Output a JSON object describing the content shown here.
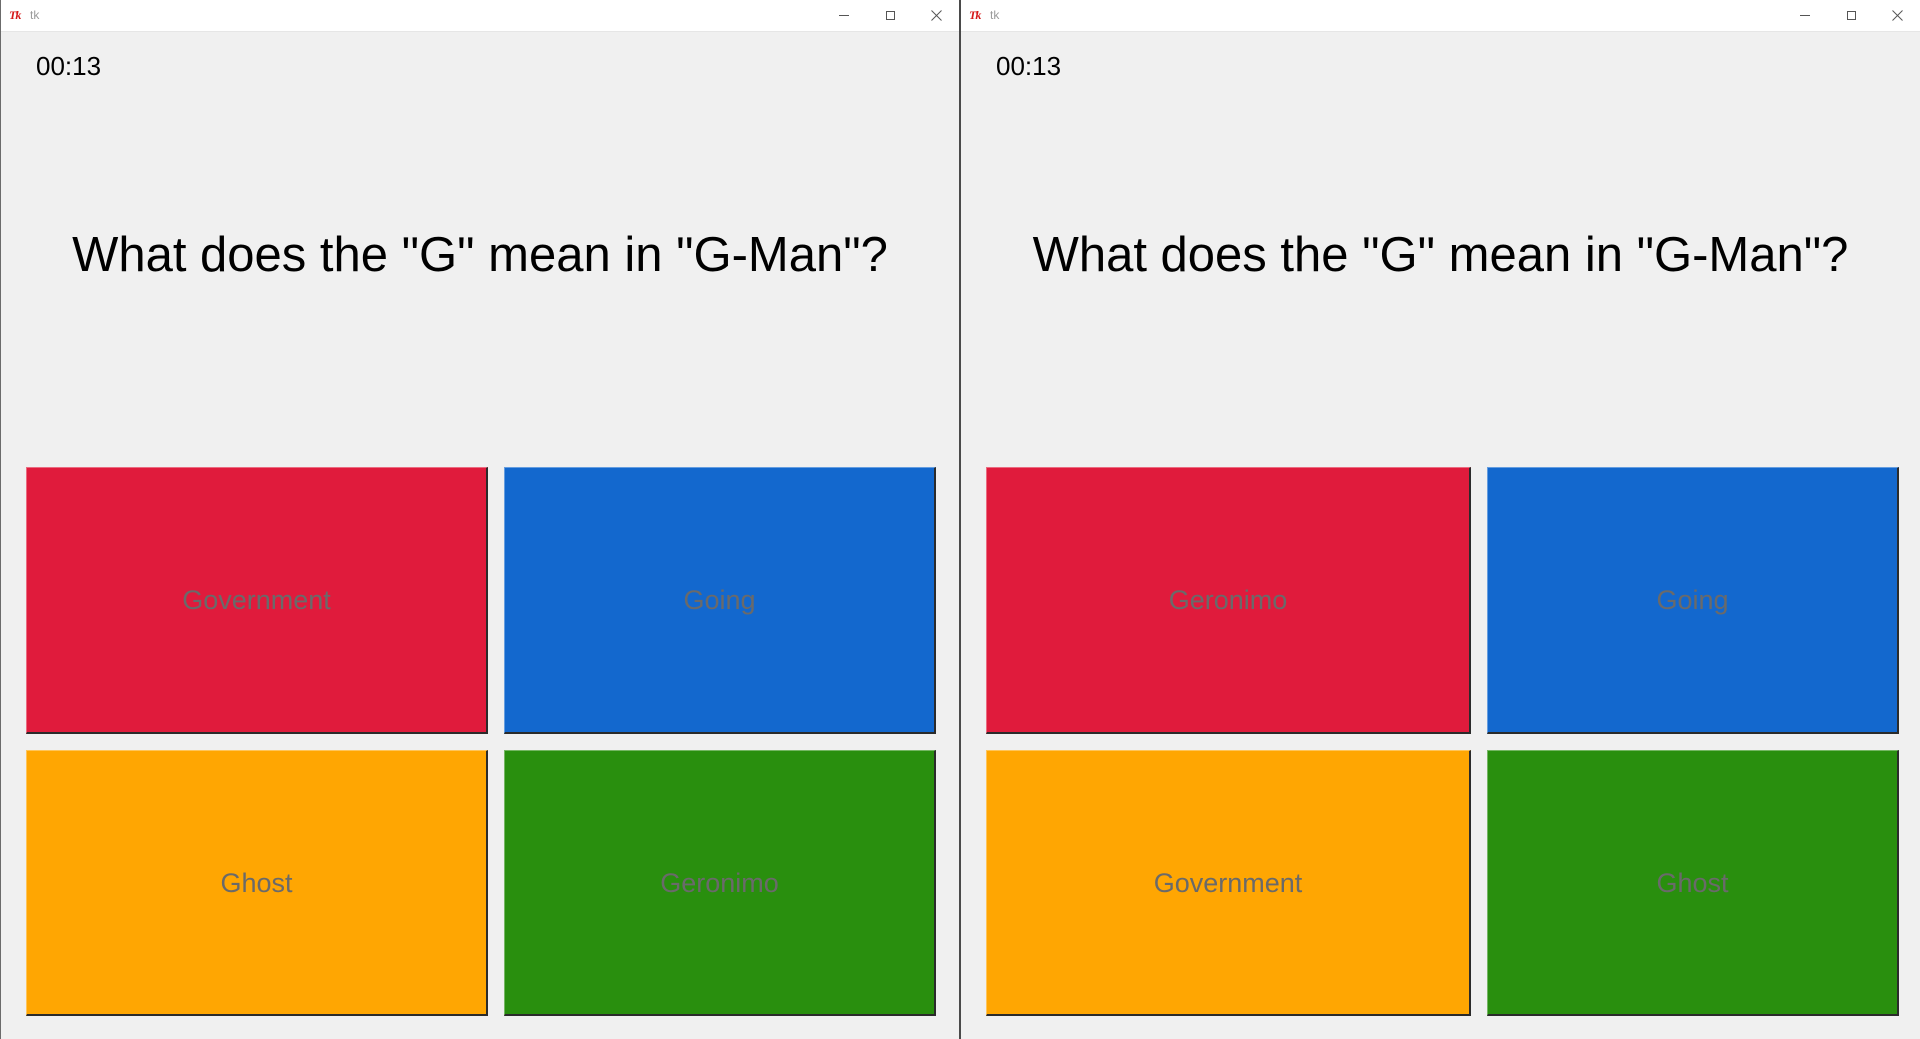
{
  "windows": [
    {
      "title": "tk",
      "timer": "00:13",
      "question": "What does the \"G\" mean in \"G-Man\"?",
      "answers": [
        {
          "label": "Government",
          "color": "#e01b3c"
        },
        {
          "label": "Going",
          "color": "#1368ce"
        },
        {
          "label": "Ghost",
          "color": "#ffa602"
        },
        {
          "label": "Geronimo",
          "color": "#298f0e"
        }
      ]
    },
    {
      "title": "tk",
      "timer": "00:13",
      "question": "What does the \"G\" mean in \"G-Man\"?",
      "answers": [
        {
          "label": "Geronimo",
          "color": "#e01b3c"
        },
        {
          "label": "Going",
          "color": "#1368ce"
        },
        {
          "label": "Government",
          "color": "#ffa602"
        },
        {
          "label": "Ghost",
          "color": "#298f0e"
        }
      ]
    }
  ],
  "icons": {
    "app": "tk-feather-icon",
    "minimize": "minimize-icon",
    "maximize": "maximize-icon",
    "close": "close-icon"
  }
}
